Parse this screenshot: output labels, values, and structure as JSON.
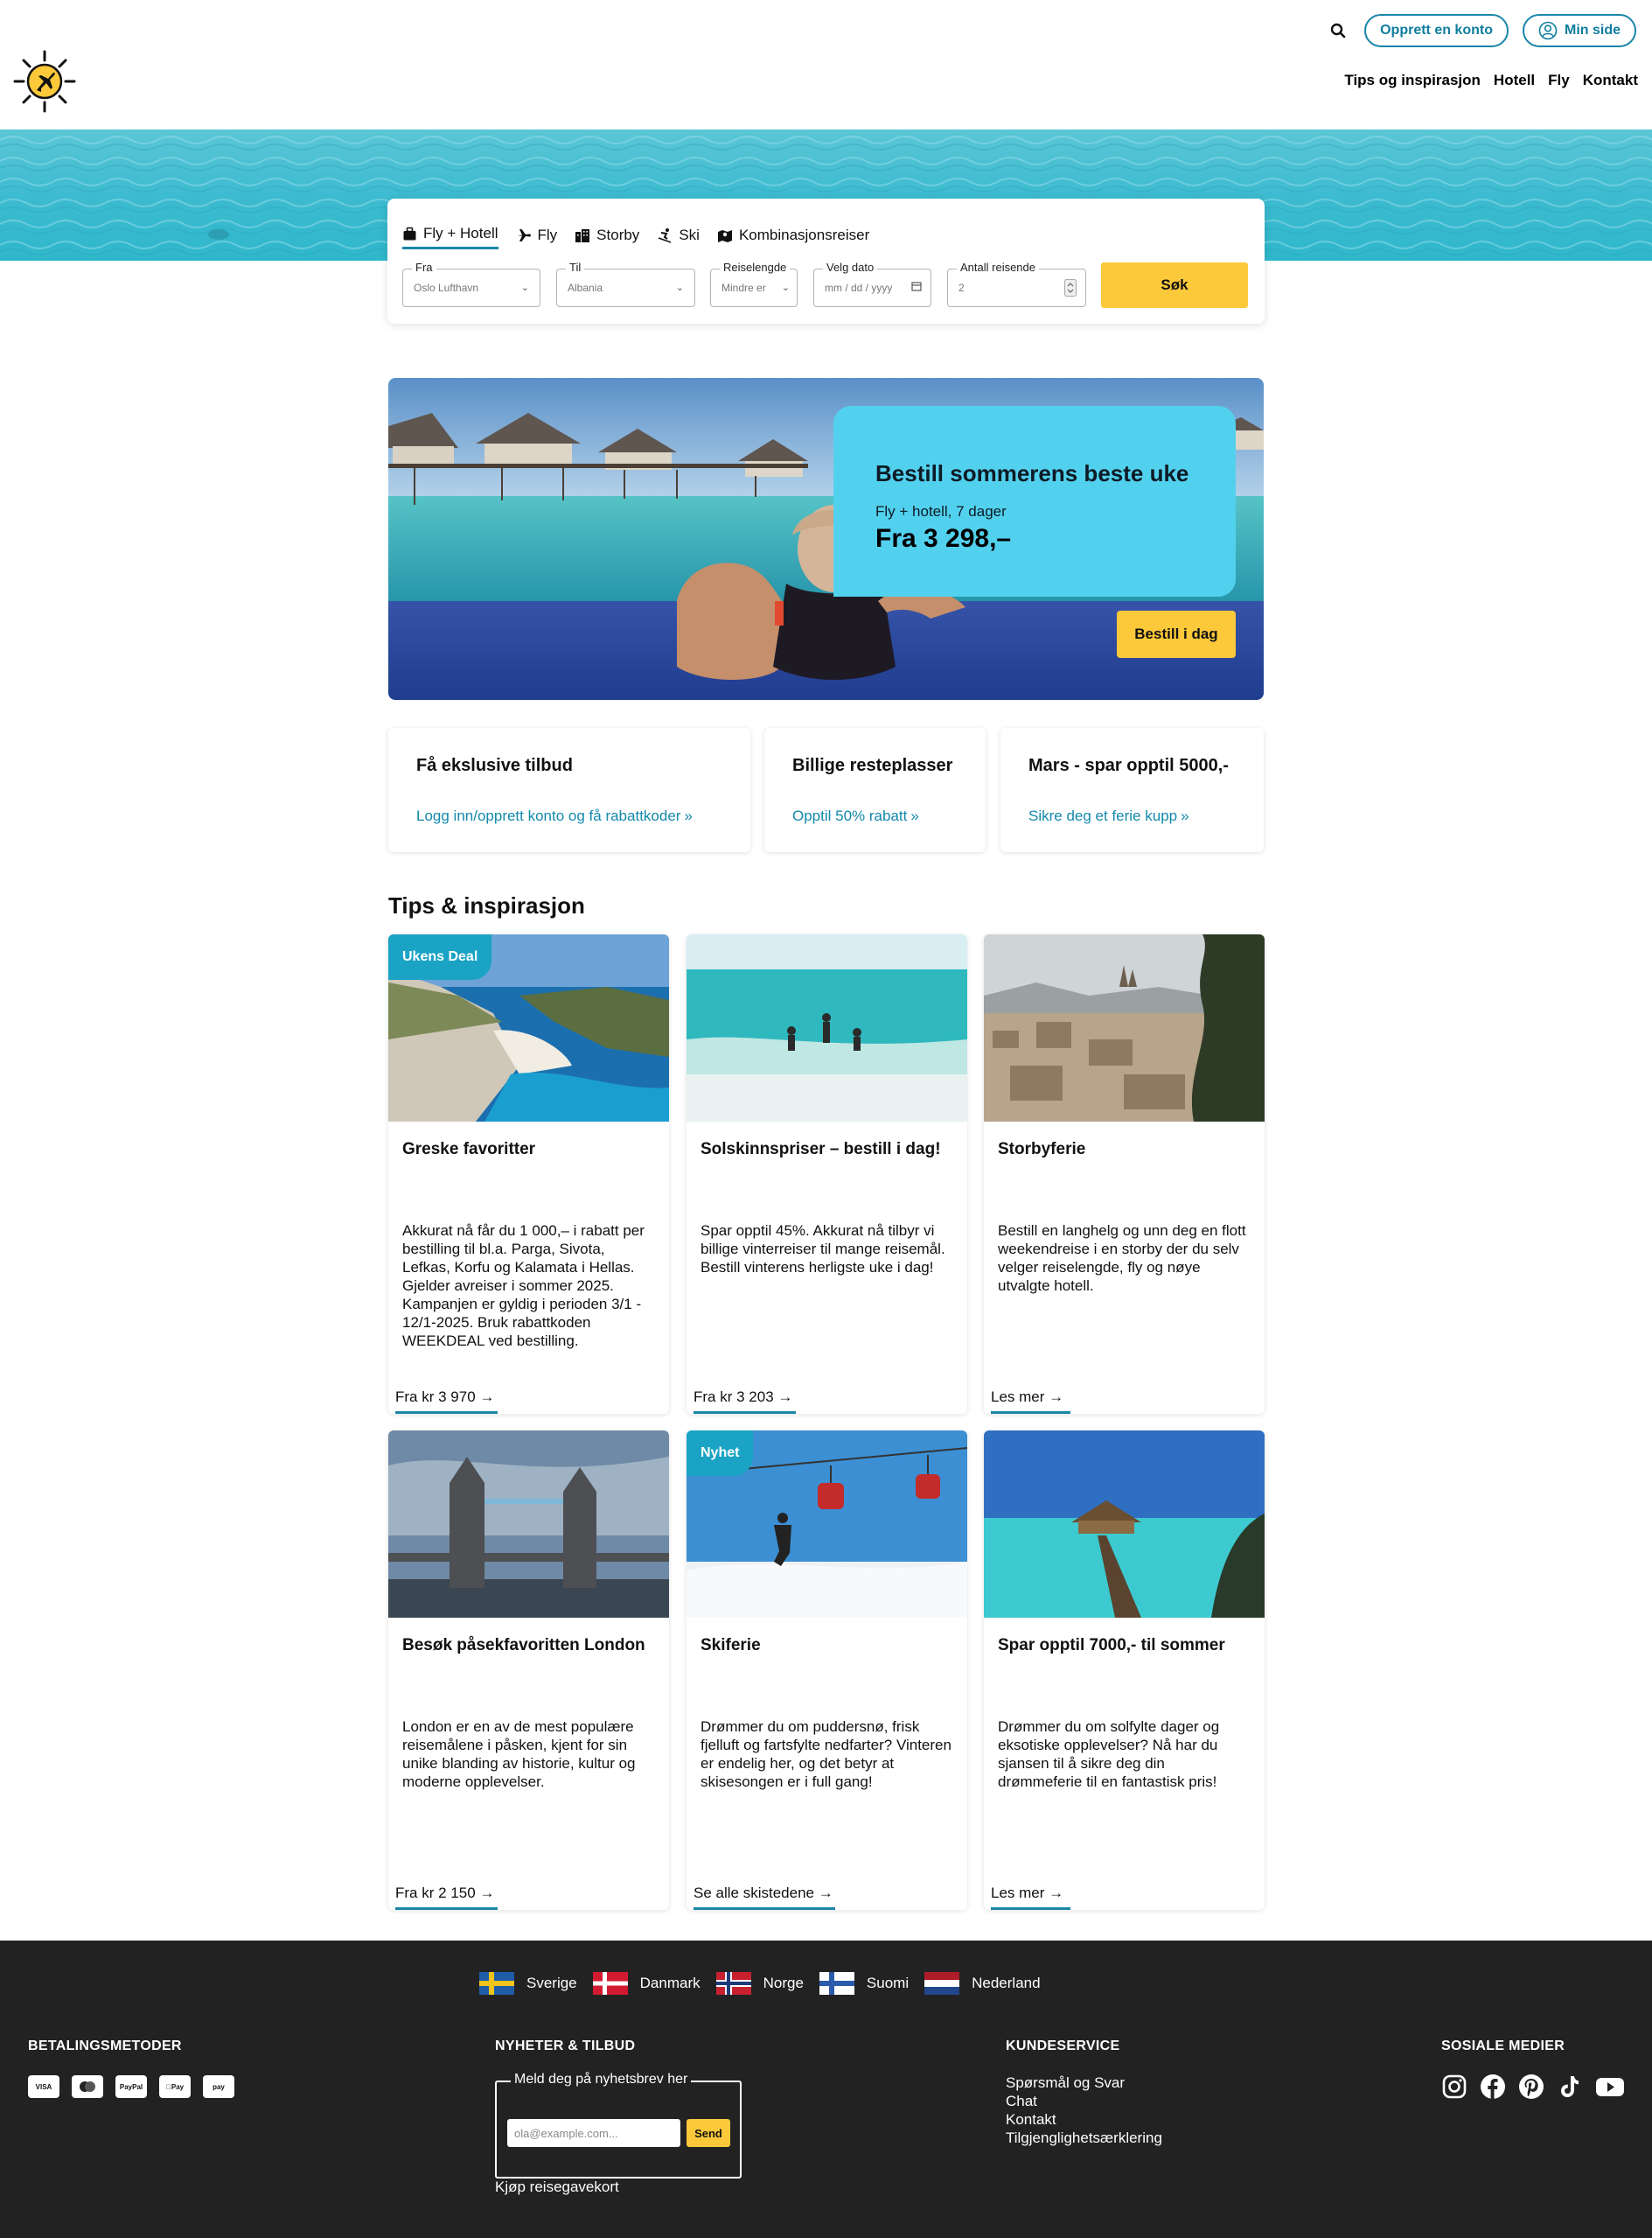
{
  "header": {
    "create_account": "Opprett en konto",
    "my_page": "Min side",
    "nav": [
      "Tips og inspirasjon",
      "Hotell",
      "Fly",
      "Kontakt"
    ]
  },
  "search": {
    "tabs": [
      "Fly + Hotell",
      "Fly",
      "Storby",
      "Ski",
      "Kombinasjonsreiser"
    ],
    "active_tab": "Fly + Hotell",
    "from_label": "Fra",
    "from_value": "Oslo Lufthavn",
    "to_label": "Til",
    "to_value": "Albania",
    "length_label": "Reiselengde",
    "length_value": "Mindre er",
    "date_label": "Velg dato",
    "date_placeholder": "mm / dd / yyyy",
    "travellers_label": "Antall reisende",
    "travellers_value": "2",
    "submit": "Søk"
  },
  "promo": {
    "title": "Bestill sommerens beste uke",
    "subtitle": "Fly + hotell, 7 dager",
    "price": "Fra 3 298,–",
    "button": "Bestill i dag"
  },
  "offers": [
    {
      "title": "Få ekslusive tilbud",
      "link": "Logg inn/opprett konto og få rabattkoder"
    },
    {
      "title": "Billige resteplasser",
      "link": "Opptil 50% rabatt"
    },
    {
      "title": "Mars - spar opptil 5000,-",
      "link": "Sikre deg et ferie kupp"
    }
  ],
  "tips": {
    "title": "Tips & inspirasjon",
    "cards": [
      {
        "badge": "Ukens Deal",
        "title": "Greske favoritter",
        "text": "Akkurat nå får du 1 000,– i rabatt per bestilling til bl.a. Parga, Sivota, Lefkas, Korfu og Kalamata i Hellas. Gjelder avreiser i sommer 2025. Kampanjen er gyldig i perioden 3/1 - 12/1-2025. Bruk rabattkoden WEEKDEAL ved bestilling.",
        "link": "Fra kr 3 970"
      },
      {
        "badge": "",
        "title": "Solskinnspriser – bestill i dag!",
        "text": "Spar opptil 45%. Akkurat nå tilbyr vi billige vinterreiser til mange reisemål. Bestill vinterens herligste uke i dag!",
        "link": "Fra kr 3 203"
      },
      {
        "badge": "",
        "title": "Storbyferie",
        "text": "Bestill en langhelg og unn deg en flott weekendreise i en storby der du selv velger reiselengde, fly og nøye utvalgte hotell.",
        "link": "Les mer"
      },
      {
        "badge": "",
        "title": "Besøk påsekfavoritten London",
        "text": "London er en av de mest populære reisemålene i påsken, kjent for sin unike blanding av historie, kultur og moderne opplevelser.",
        "link": "Fra kr 2 150"
      },
      {
        "badge": "Nyhet",
        "title": "Skiferie",
        "text": "Drømmer du om puddersnø, frisk fjelluft og fartsfylte nedfarter? Vinteren er endelig her, og det betyr at skisesongen er i full gang!",
        "link": "Se alle skistedene"
      },
      {
        "badge": "",
        "title": "Spar opptil 7000,- til sommer",
        "text": "Drømmer du om solfylte dager og eksotiske opplevelser? Nå har du sjansen til å sikre deg din drømmeferie til en fantastisk pris!",
        "link": "Les mer"
      }
    ]
  },
  "footer": {
    "countries": [
      "Sverige",
      "Danmark",
      "Norge",
      "Suomi",
      "Nederland"
    ],
    "payment_title": "BETALINGSMETODER",
    "payment_methods": [
      "VISA",
      "Mastercard",
      "PayPal",
      "Apple Pay",
      "Amazon Pay"
    ],
    "newsletter_title": "NYHETER & TILBUD",
    "newsletter_legend": "Meld deg på nyhetsbrev her",
    "newsletter_placeholder": "ola@example.com...",
    "newsletter_button": "Send",
    "gift_card": "Kjøp reisegavekort",
    "customer_service_title": "KUNDESERVICE",
    "customer_service_links": [
      "Spørsmål og Svar",
      "Chat",
      "Kontakt",
      "Tilgjenglighetsærklering"
    ],
    "social_title": "SOSIALE MEDIER",
    "social": [
      "instagram-icon",
      "facebook-icon",
      "pinterest-icon",
      "tiktok-icon",
      "youtube-icon"
    ]
  },
  "colors": {
    "accent": "#1a86a8",
    "button_yellow": "#fcc93a",
    "promo_card": "#52d1ee",
    "footer_bg": "#222222"
  }
}
